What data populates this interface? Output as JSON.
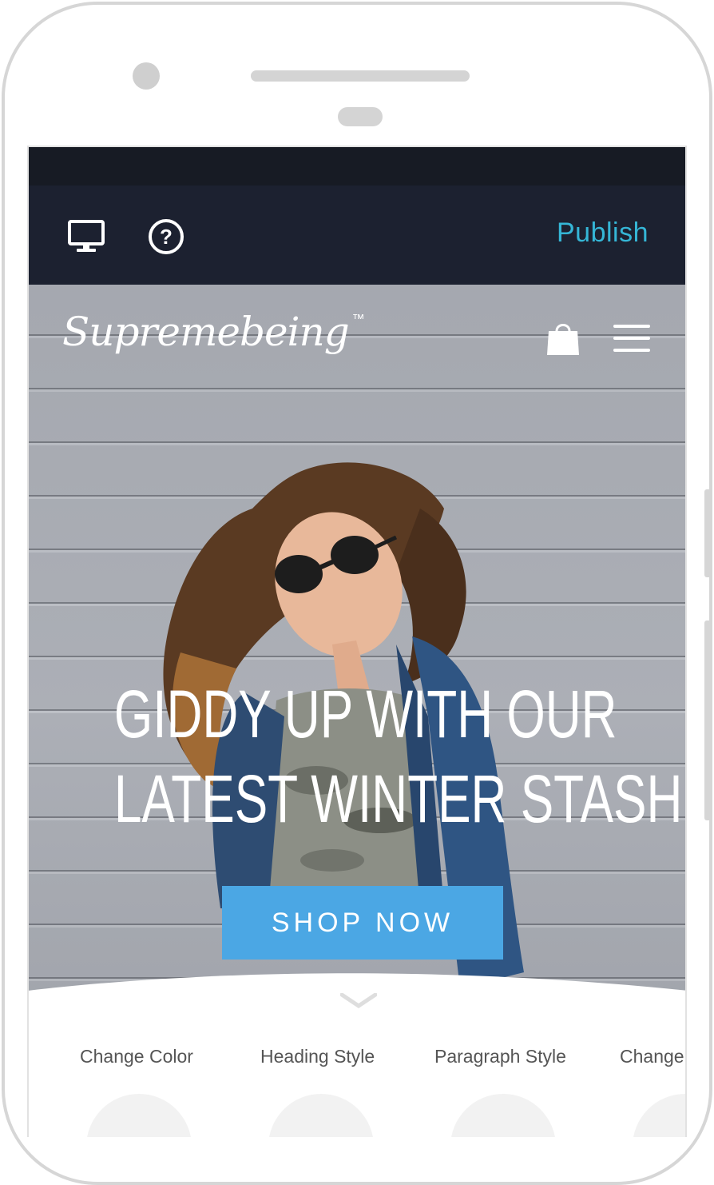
{
  "toolbar": {
    "desktop_icon": "desktop-monitor-icon",
    "help_icon": "question-circle-icon",
    "publish_label": "Publish",
    "publish_color": "#35b6d6",
    "background": "#1c2130"
  },
  "site": {
    "logo_text": "Supremebeing",
    "logo_mark": "™",
    "cart_icon": "shopping-bag-icon",
    "menu_icon": "hamburger-menu-icon"
  },
  "hero": {
    "headline_line1": "GIDDY UP WITH OUR",
    "headline_line2": "LATEST WINTER STASH",
    "cta_label": "SHOP NOW",
    "cta_color": "#4ba7e4"
  },
  "panel": {
    "expand_icon": "chevron-down-icon",
    "tabs": [
      {
        "label": "Change Color"
      },
      {
        "label": "Heading Style"
      },
      {
        "label": "Paragraph Style"
      },
      {
        "label": "Change"
      }
    ]
  }
}
